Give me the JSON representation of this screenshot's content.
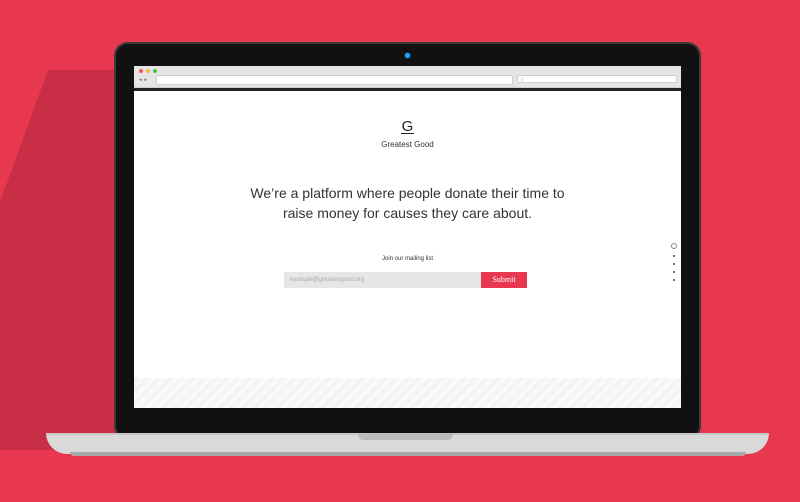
{
  "colors": {
    "background": "#e8384f",
    "accent": "#e8384f",
    "lid": "#111111"
  },
  "browser": {
    "nav_back": "◂",
    "nav_forward": "▸",
    "address_value": "",
    "search_icon": "⌕"
  },
  "site": {
    "logo_letter": "G",
    "brand_name": "Greatest Good",
    "tagline_line1": "We’re a platform where people donate their time to",
    "tagline_line2": "raise money for causes they care about.",
    "mailing_label": "Join our mailing list",
    "email_placeholder": "example@greatestgood.org",
    "submit_label": "Submit"
  },
  "side_nav": {
    "pages": 5,
    "active": 1
  }
}
